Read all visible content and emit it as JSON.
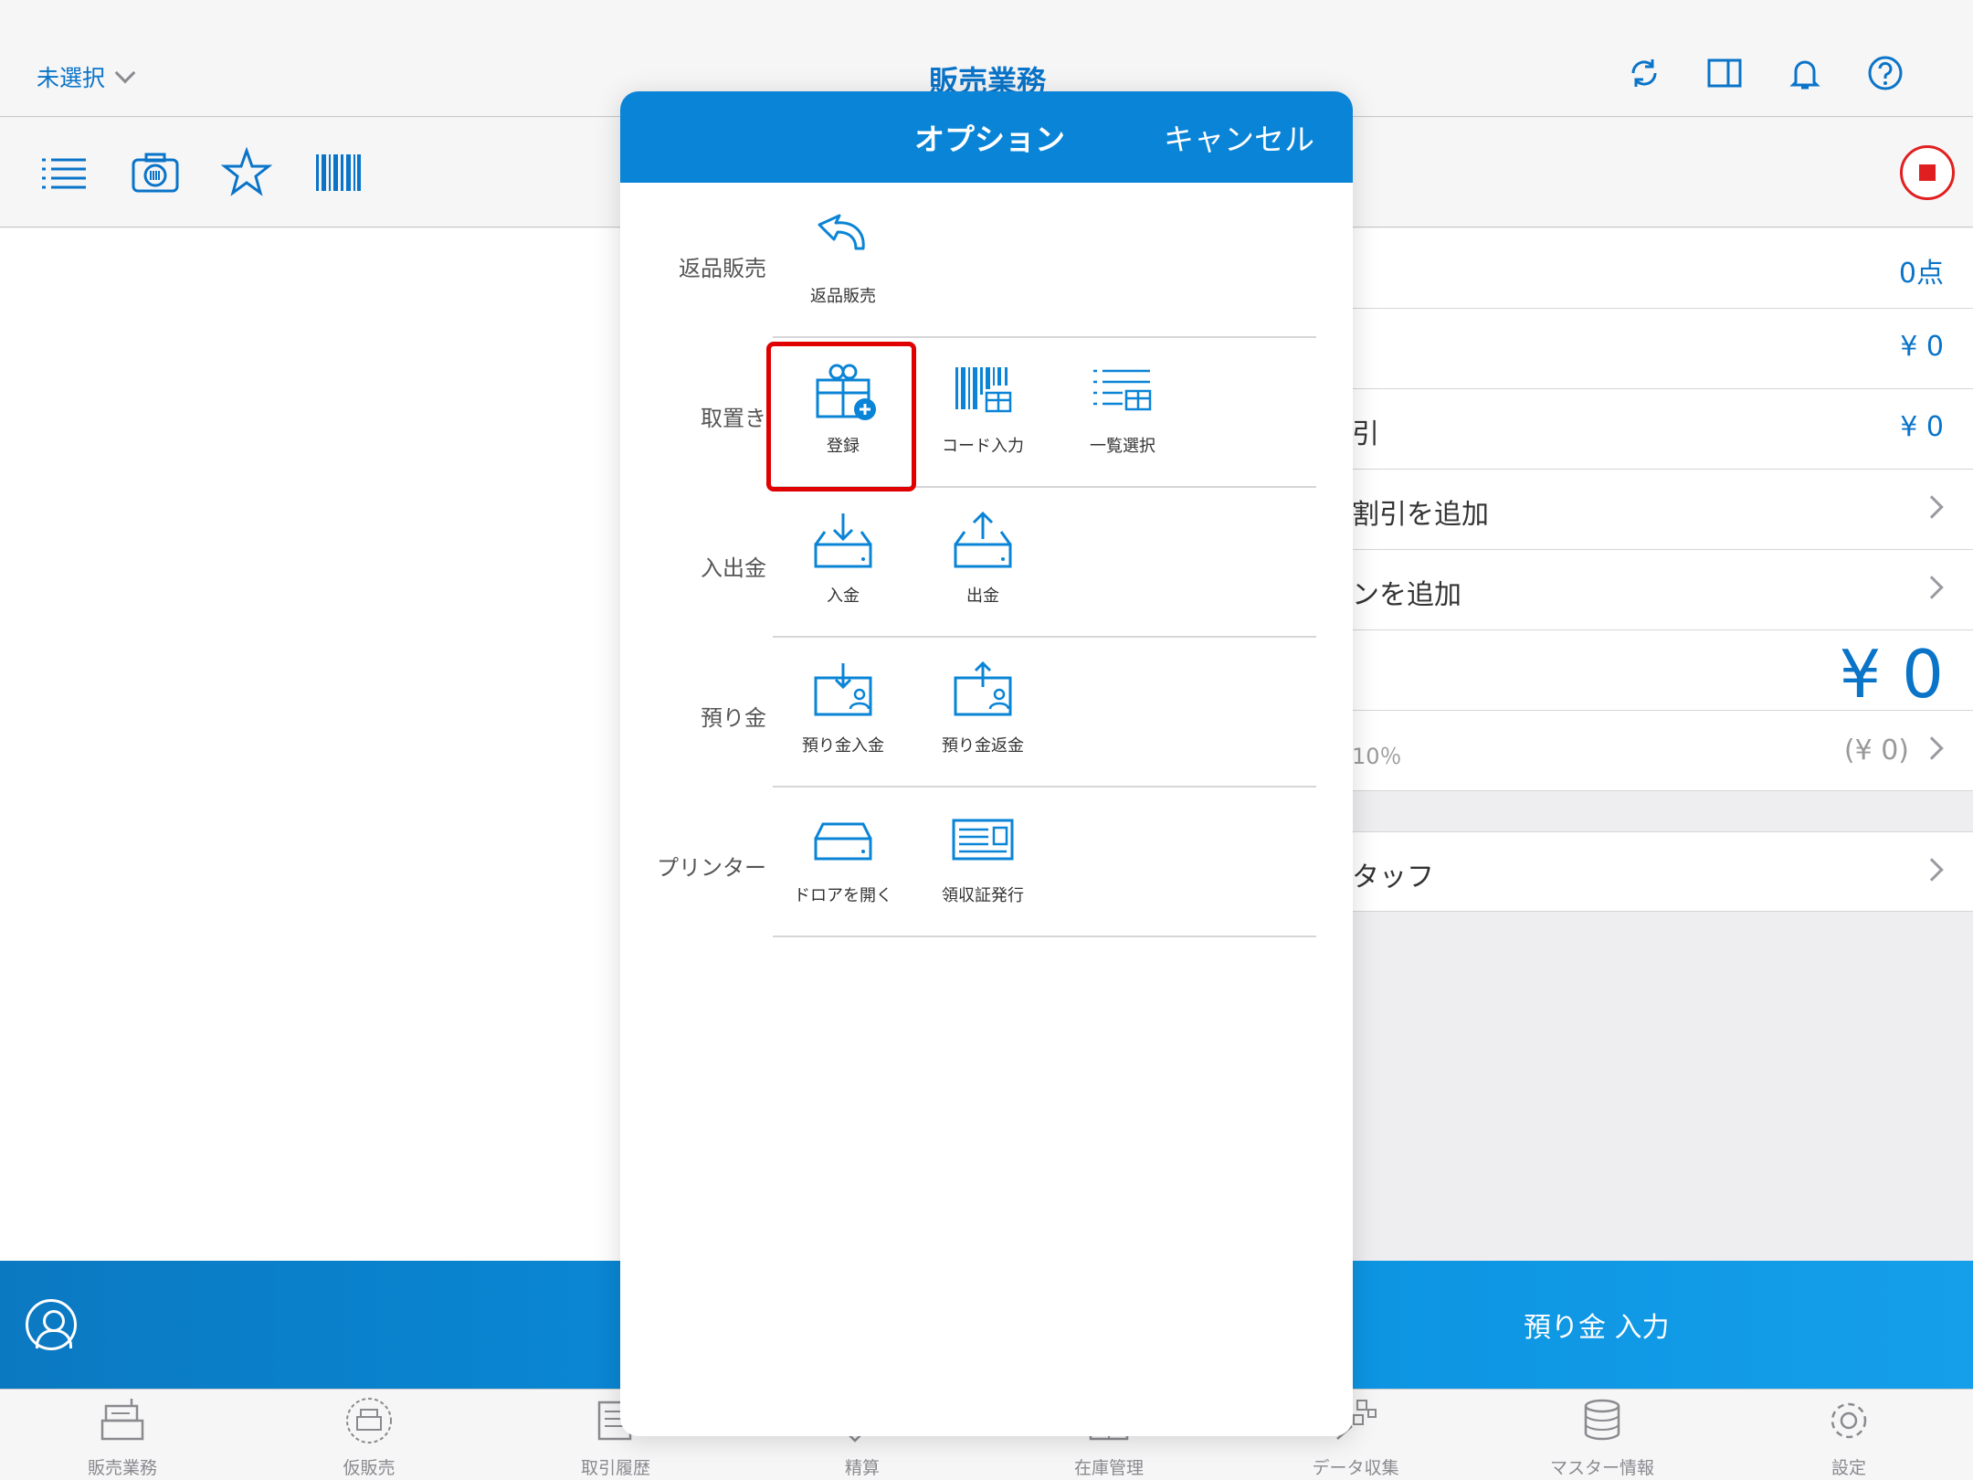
{
  "header": {
    "store_select": "未選択",
    "title": "販売業務"
  },
  "summary": {
    "qty": "0点",
    "subtotal": "¥ 0",
    "discount_label": "引",
    "discount_value": "¥ 0",
    "add_discount": "割引を追加",
    "add_coupon": "ンを追加",
    "total": "¥ 0",
    "tax_label": "10％",
    "tax_value": "(¥ 0)",
    "staff": "タッフ"
  },
  "actionbar": {
    "deposit_input": "預り金 入力"
  },
  "tabs": [
    {
      "label": "販売業務",
      "icon": "register-icon"
    },
    {
      "label": "仮販売",
      "icon": "temp-sale-icon"
    },
    {
      "label": "取引履歴",
      "icon": "history-icon"
    },
    {
      "label": "精算",
      "icon": "settlement-icon"
    },
    {
      "label": "在庫管理",
      "icon": "inventory-icon"
    },
    {
      "label": "データ収集",
      "icon": "data-collection-icon"
    },
    {
      "label": "マスター情報",
      "icon": "master-data-icon"
    },
    {
      "label": "設定",
      "icon": "settings-gear-icon"
    }
  ],
  "modal": {
    "title": "オプション",
    "cancel": "キャンセル",
    "sections": [
      {
        "label": "返品販売",
        "options": [
          {
            "label": "返品販売",
            "icon": "return-arrow-icon"
          }
        ]
      },
      {
        "label": "取置き",
        "options": [
          {
            "label": "登録",
            "icon": "gift-add-icon"
          },
          {
            "label": "コード入力",
            "icon": "barcode-gift-icon"
          },
          {
            "label": "一覧選択",
            "icon": "list-gift-icon"
          }
        ]
      },
      {
        "label": "入出金",
        "options": [
          {
            "label": "入金",
            "icon": "tray-in-icon"
          },
          {
            "label": "出金",
            "icon": "tray-out-icon"
          }
        ]
      },
      {
        "label": "預り金",
        "options": [
          {
            "label": "預り金入金",
            "icon": "deposit-in-icon"
          },
          {
            "label": "預り金返金",
            "icon": "deposit-refund-icon"
          }
        ]
      },
      {
        "label": "プリンター",
        "options": [
          {
            "label": "ドロアを開く",
            "icon": "drawer-icon"
          },
          {
            "label": "領収証発行",
            "icon": "receipt-icon"
          }
        ]
      }
    ]
  },
  "colors": {
    "accent": "#0a84d6",
    "highlight": "#e00000"
  }
}
